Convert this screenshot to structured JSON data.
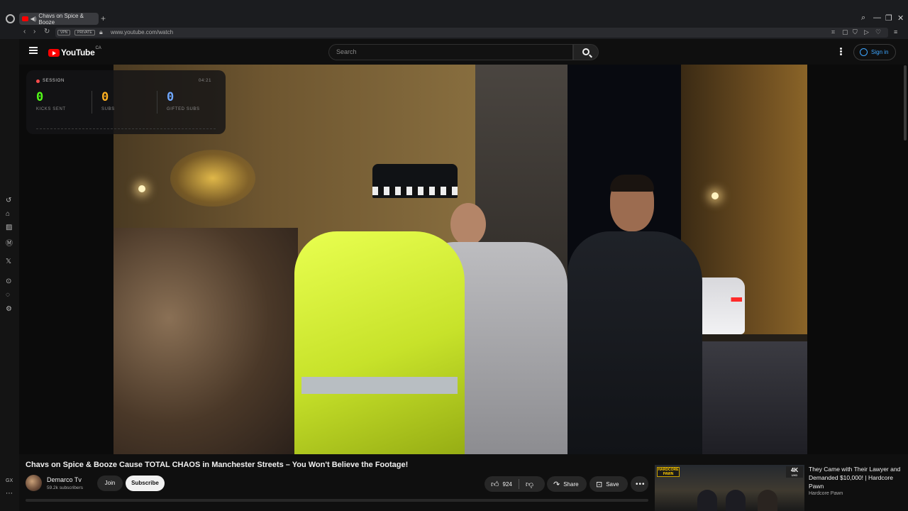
{
  "browser": {
    "tab_title": "Chavs on Spice & Booze",
    "new_tab": "+",
    "url": "www.youtube.com/watch",
    "vpn_label": "VPN",
    "private_label": "PRIVATE",
    "sidebar_bottom_label": "GX",
    "sidebar_icons": [
      "history-icon",
      "box-icon",
      "stripes-icon",
      "m-icon",
      "x-logo-icon",
      "play-circle-icon",
      "chat-icon",
      "settings-icon"
    ]
  },
  "youtube": {
    "logo_word": "YouTube",
    "region": "CA",
    "search_placeholder": "Search",
    "sign_in": "Sign in"
  },
  "overlay": {
    "session_label": "SESSION",
    "timer": "04:21",
    "kicks_value": "0",
    "kicks_label": "KICKS SENT",
    "subs_value": "0",
    "subs_label": "SUBS",
    "gifted_value": "0",
    "gifted_label": "GIFTED SUBS",
    "colors": {
      "kicks": "#53fc18",
      "subs": "#ffb020",
      "gifted": "#6fa8ff",
      "live_dot": "#ff4d4d"
    }
  },
  "video": {
    "title": "Chavs on Spice & Booze Cause TOTAL CHAOS in Manchester Streets – You Won't Believe the Footage!",
    "channel_name": "Demarco Tv",
    "subscribers": "59.2k subscribers",
    "join_label": "Join",
    "subscribe_label": "Subscribe",
    "like_count": "924",
    "share_label": "Share",
    "save_label": "Save",
    "more_label": "•••"
  },
  "recommendation": {
    "title": "They Came with Their Lawyer and Demanded $10,000! | Hardcore Pawn",
    "channel": "Hardcore Pawn",
    "badge_4k": "4K",
    "badge_4k_sub": "UHD",
    "badge_show": "HARDCORE PAWN"
  }
}
